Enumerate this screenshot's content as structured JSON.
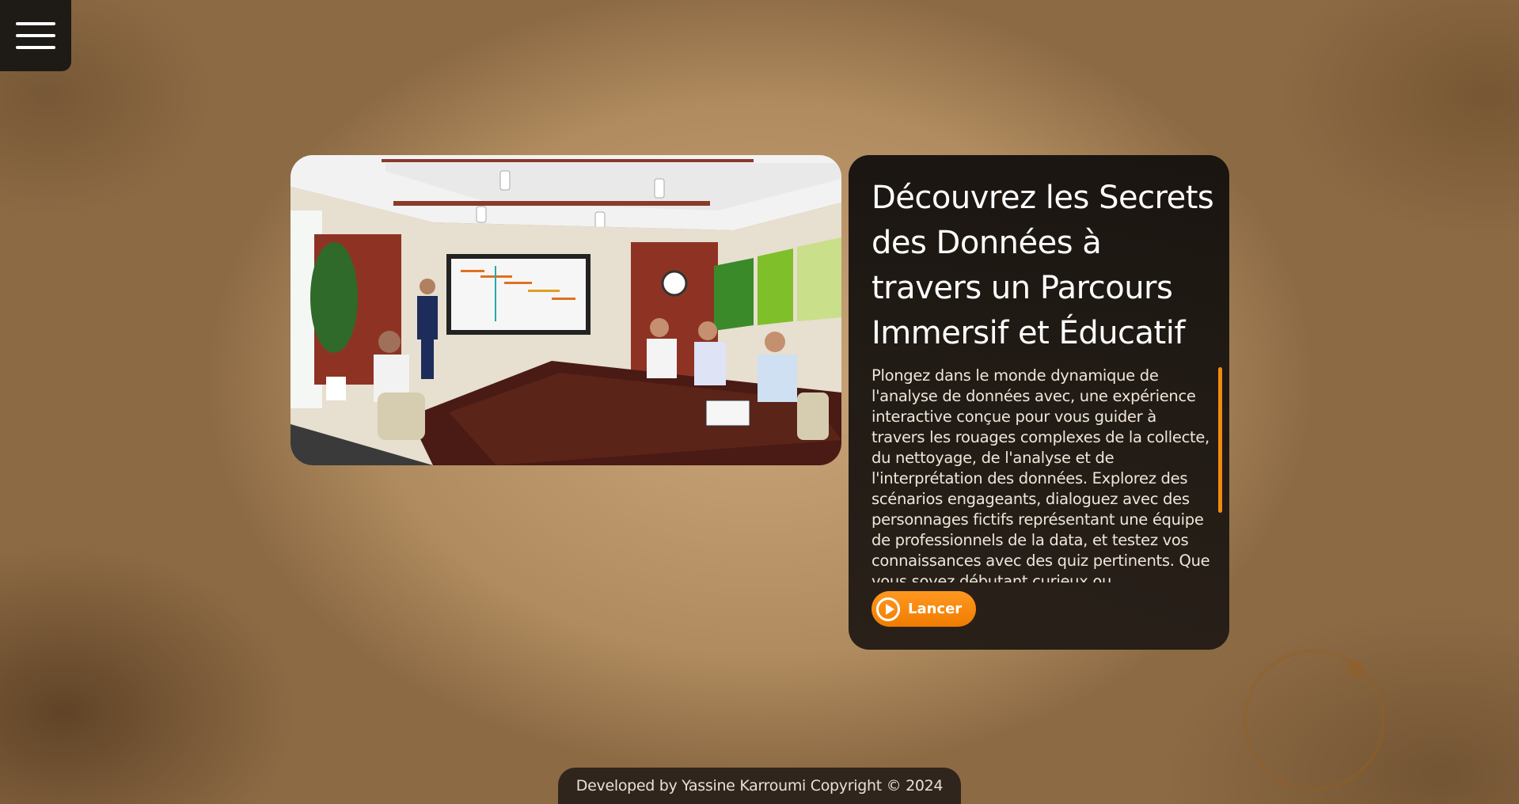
{
  "menu": {
    "icon": "hamburger-menu-icon"
  },
  "hero": {
    "image_alt": "Conference room scene"
  },
  "card": {
    "title": "Découvrez les Secrets des Données à travers un Parcours Immersif et Éducatif",
    "description": "Plongez dans le monde dynamique de l'analyse de données avec, une expérience interactive conçue pour vous guider à travers les rouages complexes de la collecte, du nettoyage, de l'analyse et de l'interprétation des données. Explorez des scénarios engageants, dialoguez avec des personnages fictifs représentant une équipe de professionnels de la data, et testez vos connaissances avec des quiz pertinents. Que vous soyez débutant curieux ou",
    "launch_label": "Lancer",
    "launch_icon": "play-circle-icon"
  },
  "footer": {
    "text": "Developed by Yassine Karroumi Copyright © 2024"
  },
  "colors": {
    "accent": "#f08a12",
    "card_bg": "#1e1a16"
  }
}
